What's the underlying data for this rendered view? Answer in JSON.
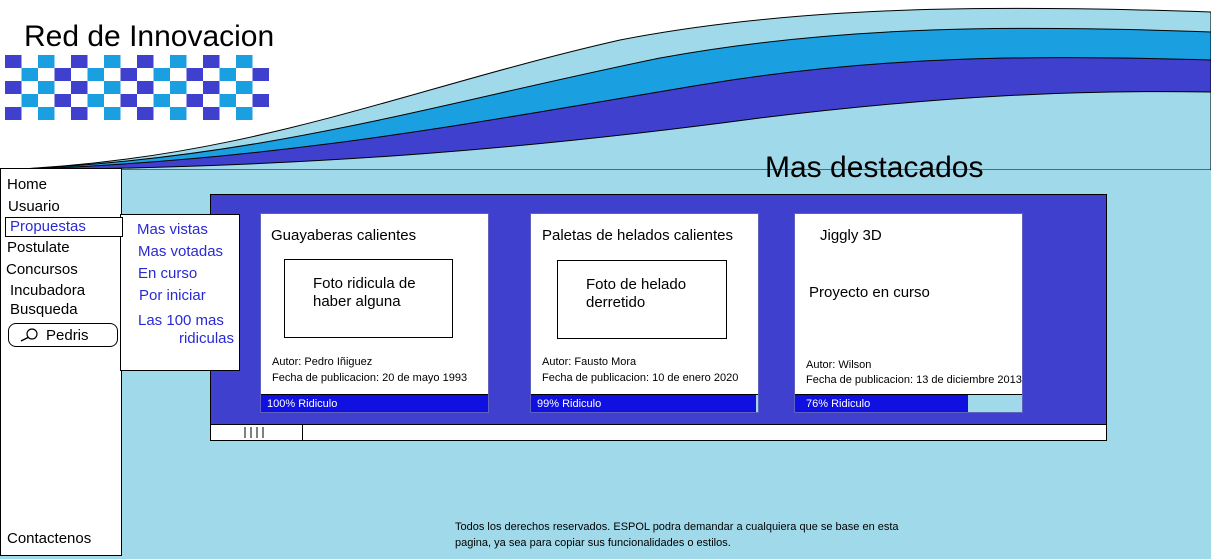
{
  "header": {
    "title": "Red de Innovacion"
  },
  "colors": {
    "background": "#a0daea",
    "dark_blue": "#4040cf",
    "mid_blue": "#1a9fe0",
    "light_blue": "#a0daea",
    "link": "#2a2ad4",
    "bar_fill": "#1010e0"
  },
  "sidebar": {
    "items": [
      "Home",
      "Usuario",
      "Propuestas",
      "Postulate",
      "Concursos",
      "Incubadora",
      "Busqueda"
    ],
    "search_value": "Pedris",
    "search_icon": "search-icon",
    "contact": "Contactenos"
  },
  "submenu": {
    "items": [
      "Mas vistas",
      "Mas votadas",
      "En curso",
      "Por iniciar"
    ],
    "last_line1": "Las 100 mas",
    "last_line2": "ridiculas"
  },
  "main": {
    "title": "Mas destacados"
  },
  "cards": [
    {
      "title": "Guayaberas calientes",
      "photo_line1": "Foto ridicula de",
      "photo_line2": "haber alguna",
      "author": "Autor: Pedro Iñiguez",
      "date": "Fecha de publicacion: 20 de mayo 1993",
      "percent_label": "100% Ridiculo",
      "percent": 100
    },
    {
      "title": "Paletas de helados calientes",
      "photo_line1": "Foto de helado",
      "photo_line2": "derretido",
      "author": "Autor: Fausto Mora",
      "date": "Fecha de publicacion: 10 de enero 2020",
      "percent_label": "99% Ridiculo",
      "percent": 99
    },
    {
      "title": "Jiggly 3D",
      "text": "Proyecto en curso",
      "author": "Autor: Wilson",
      "date": "Fecha de publicacion: 13 de diciembre 2013",
      "percent_label": "76% Ridiculo",
      "percent": 76
    }
  ],
  "footer": {
    "line1": "Todos los derechos reservados. ESPOL podra demandar a cualquiera que se base en esta",
    "line2": "pagina, ya sea para copiar sus funcionalidades o estilos."
  }
}
